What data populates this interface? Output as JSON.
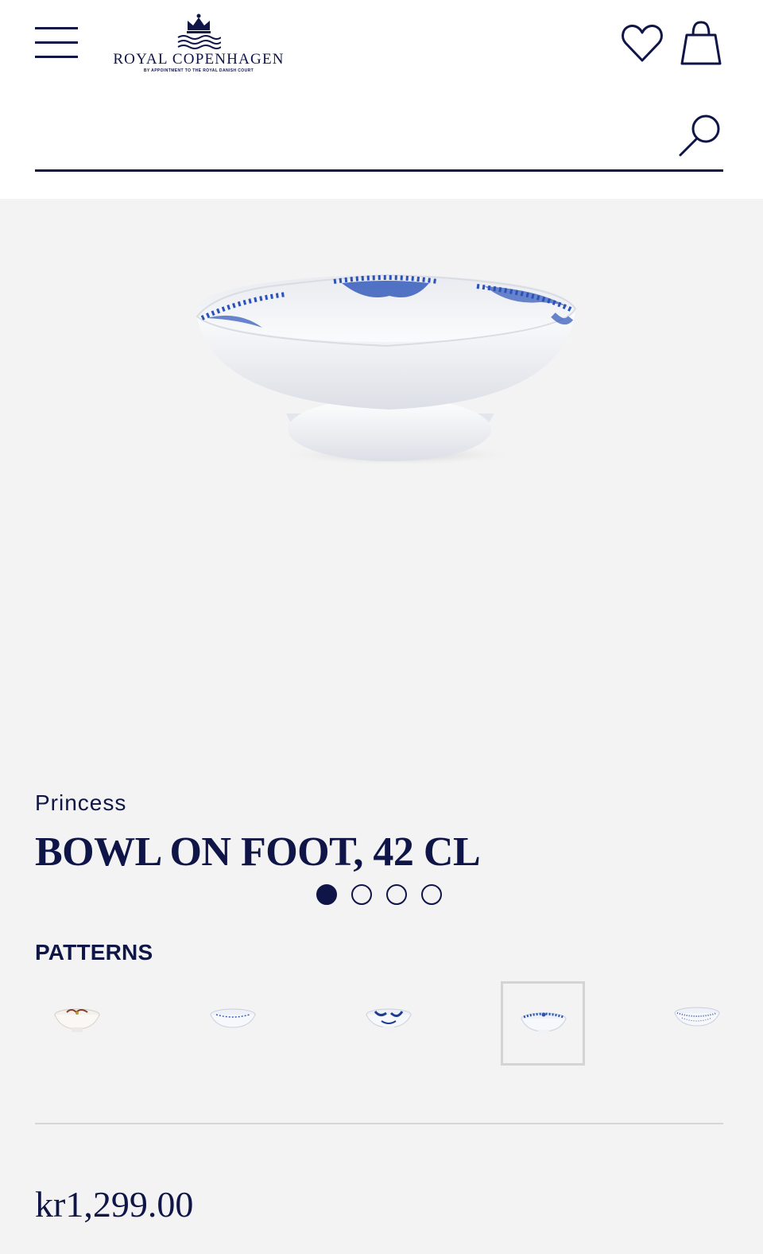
{
  "header": {
    "brand": "ROYAL COPENHAGEN",
    "brand_tagline": "BY APPOINTMENT TO THE ROYAL DANISH COURT",
    "icons": [
      "menu-icon",
      "crown-logo-icon",
      "heart-icon",
      "shopping-bag-icon",
      "search-icon"
    ]
  },
  "search": {
    "placeholder": "",
    "value": ""
  },
  "gallery": {
    "image_count": 4,
    "active_index": 0
  },
  "product": {
    "collection": "Princess",
    "title": "BOWL ON FOOT, 42 CL",
    "patterns_label": "PATTERNS",
    "patterns": [
      {
        "pattern": "star-fluted-christmas",
        "selected": false
      },
      {
        "pattern": "blue-fluted-plain",
        "selected": false
      },
      {
        "pattern": "blue-fluted-mega",
        "selected": false
      },
      {
        "pattern": "princess",
        "selected": true
      },
      {
        "pattern": "blue-fluted-full-lace",
        "selected": false
      }
    ],
    "price": "kr1,299.00"
  },
  "colors": {
    "brand_navy": "#0f1547",
    "background": "#f3f3f3",
    "header_bg": "#ffffff",
    "porcelain_blue": "#2b52b8"
  }
}
